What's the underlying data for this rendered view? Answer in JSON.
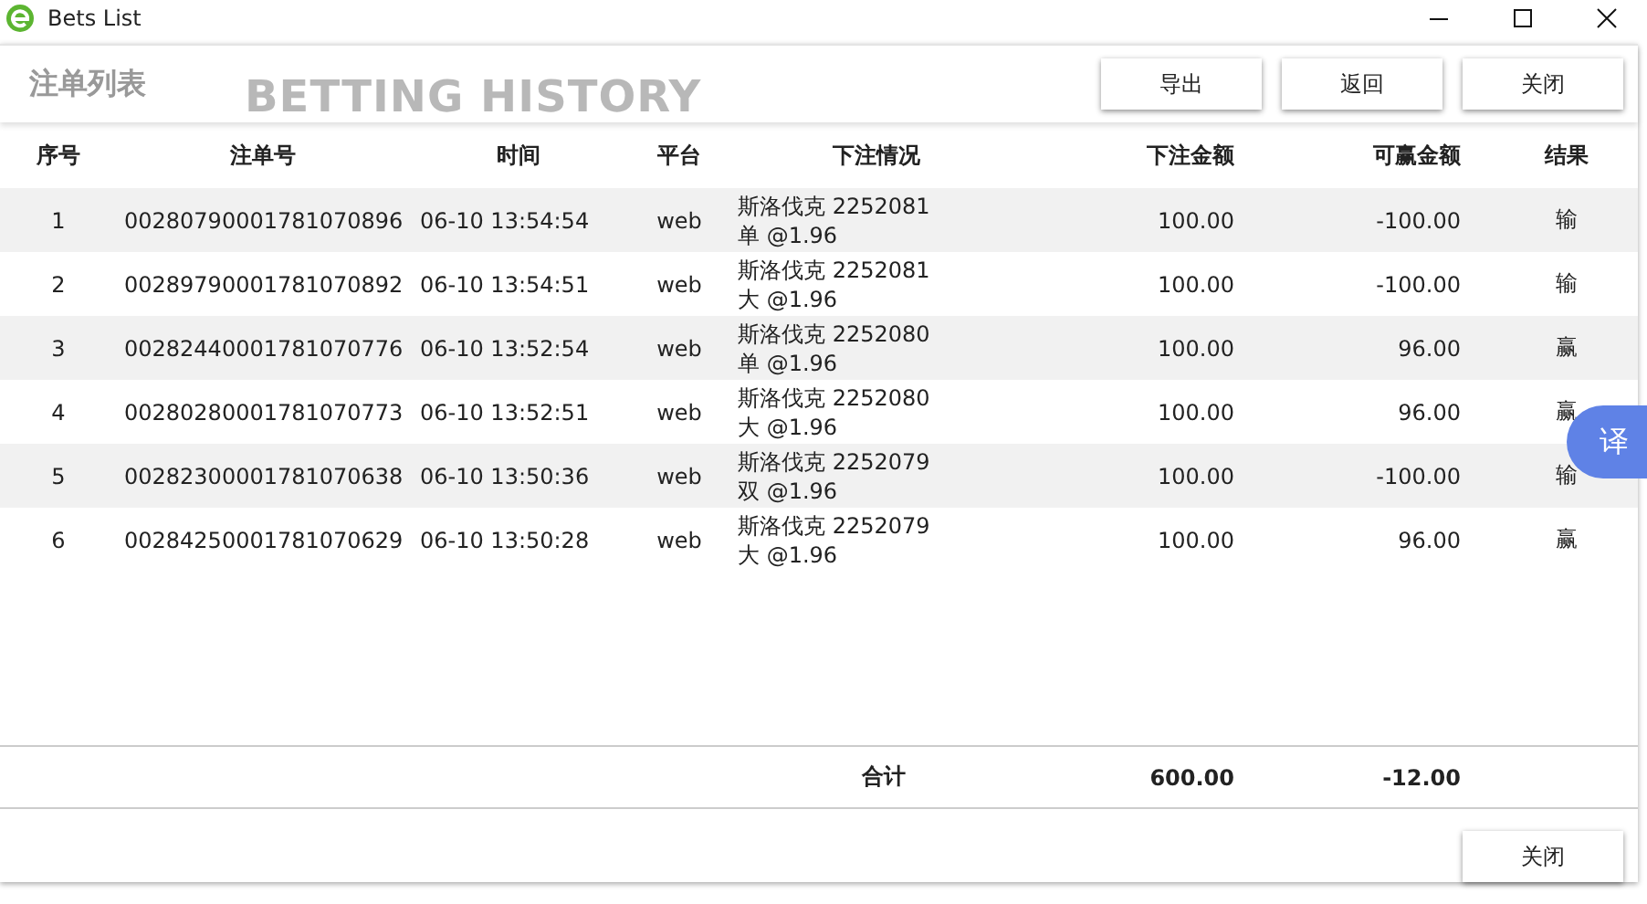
{
  "window": {
    "title": "Bets List"
  },
  "header": {
    "title": "注单列表",
    "backdrop_text": "BETTING HISTORY",
    "buttons": [
      "导出",
      "返回",
      "关闭"
    ]
  },
  "table": {
    "columns": [
      "序号",
      "注单号",
      "时间",
      "平台",
      "下注情况",
      "下注金额",
      "可赢金额",
      "结果"
    ],
    "rows": [
      {
        "no": "1",
        "bet_id": "00280790001781070896",
        "time": "06-10 13:54:54",
        "platform": "web",
        "detail": [
          "斯洛伐克 2252081",
          "单 @1.96"
        ],
        "amount": "100.00",
        "win": "-100.00",
        "result": "输"
      },
      {
        "no": "2",
        "bet_id": "00289790001781070892",
        "time": "06-10 13:54:51",
        "platform": "web",
        "detail": [
          "斯洛伐克 2252081",
          "大 @1.96"
        ],
        "amount": "100.00",
        "win": "-100.00",
        "result": "输"
      },
      {
        "no": "3",
        "bet_id": "00282440001781070776",
        "time": "06-10 13:52:54",
        "platform": "web",
        "detail": [
          "斯洛伐克 2252080",
          "单 @1.96"
        ],
        "amount": "100.00",
        "win": "96.00",
        "result": "赢"
      },
      {
        "no": "4",
        "bet_id": "00280280001781070773",
        "time": "06-10 13:52:51",
        "platform": "web",
        "detail": [
          "斯洛伐克 2252080",
          "大 @1.96"
        ],
        "amount": "100.00",
        "win": "96.00",
        "result": "赢"
      },
      {
        "no": "5",
        "bet_id": "00282300001781070638",
        "time": "06-10 13:50:36",
        "platform": "web",
        "detail": [
          "斯洛伐克 2252079",
          "双 @1.96"
        ],
        "amount": "100.00",
        "win": "-100.00",
        "result": "输"
      },
      {
        "no": "6",
        "bet_id": "00284250001781070629",
        "time": "06-10 13:50:28",
        "platform": "web",
        "detail": [
          "斯洛伐克 2252079",
          "大 @1.96"
        ],
        "amount": "100.00",
        "win": "96.00",
        "result": "赢"
      }
    ],
    "totals": {
      "label": "合计",
      "amount": "600.00",
      "win": "-12.00"
    }
  },
  "footer": {
    "buttons": [
      "关闭"
    ]
  },
  "translate_button": {
    "label": "译"
  }
}
